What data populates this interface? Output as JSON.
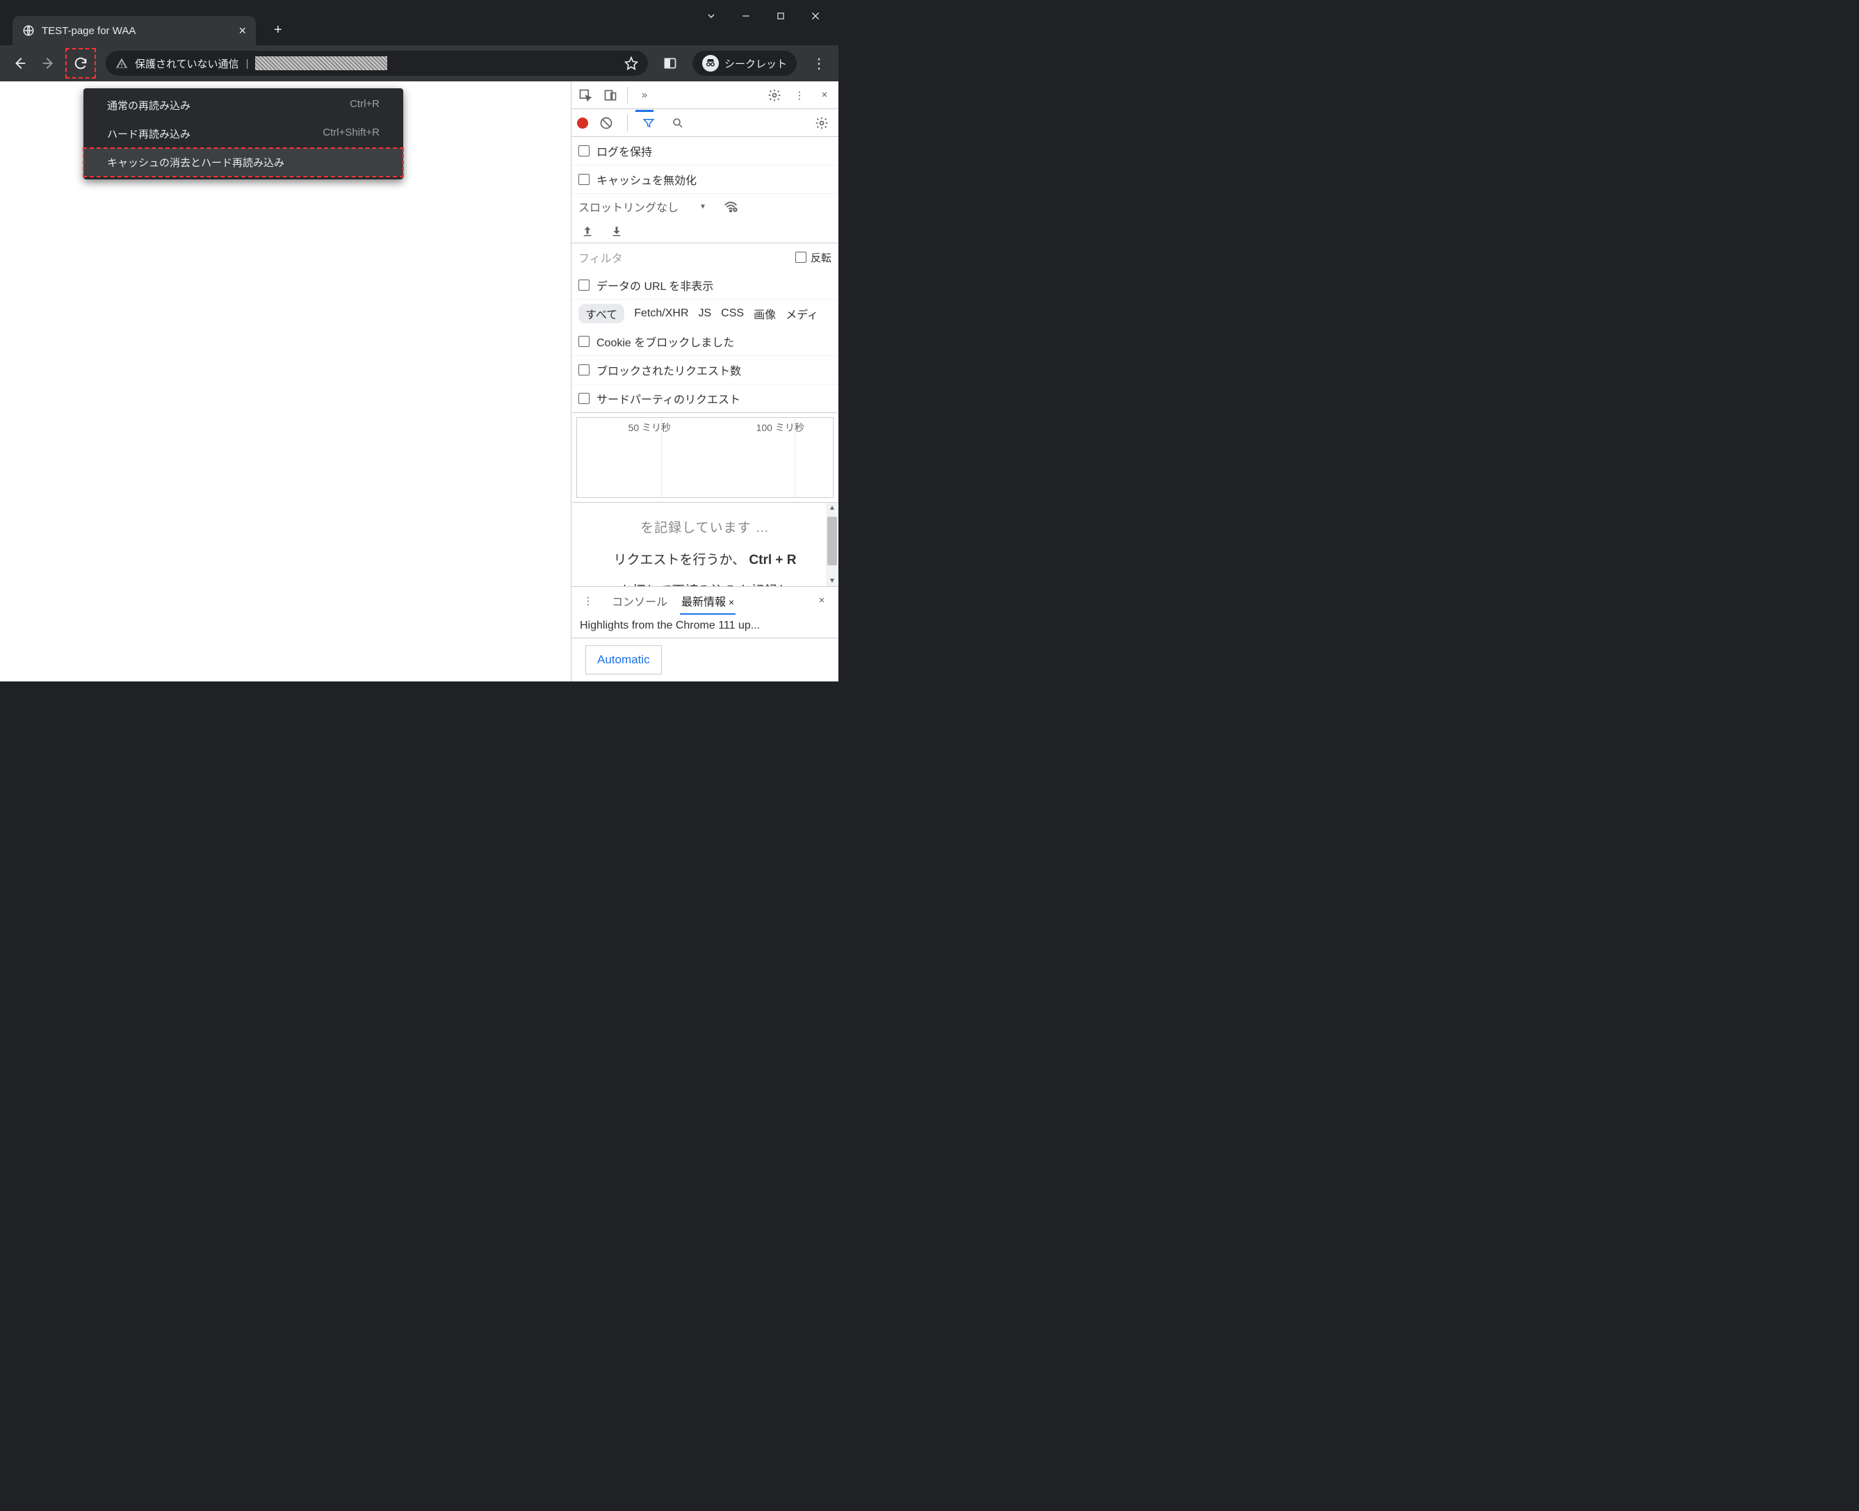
{
  "window": {
    "tab_title": "TEST-page for WAA"
  },
  "toolbar": {
    "security_label": "保護されていない通信",
    "incognito_label": "シークレット"
  },
  "context_menu": {
    "items": [
      {
        "label": "通常の再読み込み",
        "shortcut": "Ctrl+R"
      },
      {
        "label": "ハード再読み込み",
        "shortcut": "Ctrl+Shift+R"
      },
      {
        "label": "キャッシュの消去とハード再読み込み",
        "shortcut": ""
      }
    ]
  },
  "devtools": {
    "preserve_log": "ログを保持",
    "disable_cache": "キャッシュを無効化",
    "throttling": "スロットリングなし",
    "filter_placeholder": "フィルタ",
    "invert": "反転",
    "hide_data_urls": "データの URL を非表示",
    "type_filters": {
      "all": "すべて",
      "fetch": "Fetch/XHR",
      "js": "JS",
      "css": "CSS",
      "img": "画像",
      "media": "メディ"
    },
    "blocked_cookies": "Cookie をブロックしました",
    "blocked_requests": "ブロックされたリクエスト数",
    "third_party": "サードパーティのリクエスト",
    "timeline": {
      "tick1": "50 ミリ秒",
      "tick2": "100 ミリ秒"
    },
    "placeholder_line0": "を記録しています …",
    "placeholder_line1_a": "リクエストを行うか、",
    "placeholder_line1_b": "Ctrl + R",
    "placeholder_line2": "を押して再読み込みを記録し",
    "drawer": {
      "console": "コンソール",
      "whatsnew": "最新情報",
      "highlights": "Highlights from the Chrome 111 up...",
      "card": "Automatic"
    }
  }
}
